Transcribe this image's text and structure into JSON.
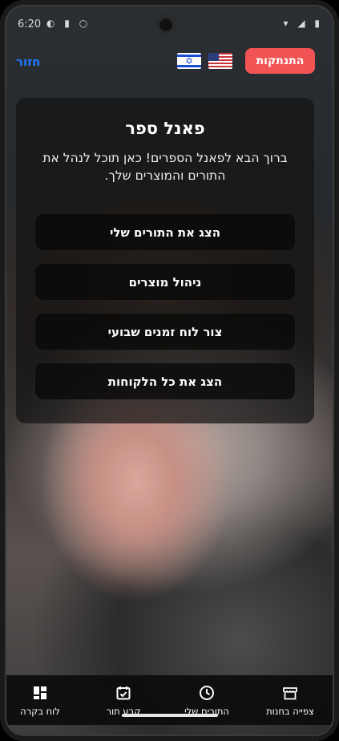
{
  "status_bar": {
    "time": "6:20",
    "left_icons": "◐ ▮ ○",
    "right_icons": "▾ ◢ ▮"
  },
  "topbar": {
    "back_label": "חזור",
    "logout_label": "התנתקות",
    "flags": [
      "israel-flag-icon",
      "usa-flag-icon"
    ]
  },
  "panel": {
    "title": "פאנל ספר",
    "description": "ברוך הבא לפאנל הספרים! כאן תוכל לנהל את התורים והמוצרים שלך.",
    "buttons": [
      {
        "label": "הצג את התורים שלי"
      },
      {
        "label": "ניהול מוצרים"
      },
      {
        "label": "צור לוח זמנים שבועי"
      },
      {
        "label": "הצג את כל הלקוחות"
      }
    ]
  },
  "tabbar": {
    "tabs": [
      {
        "label": "לוח בקרה",
        "icon": "dashboard-icon"
      },
      {
        "label": "קבע תור",
        "icon": "calendar-check-icon"
      },
      {
        "label": "התורים שלי",
        "icon": "clock-icon"
      },
      {
        "label": "צפייה בחנות",
        "icon": "store-icon"
      }
    ]
  },
  "colors": {
    "accent": "#1e7cff",
    "logout": "#f05454"
  }
}
